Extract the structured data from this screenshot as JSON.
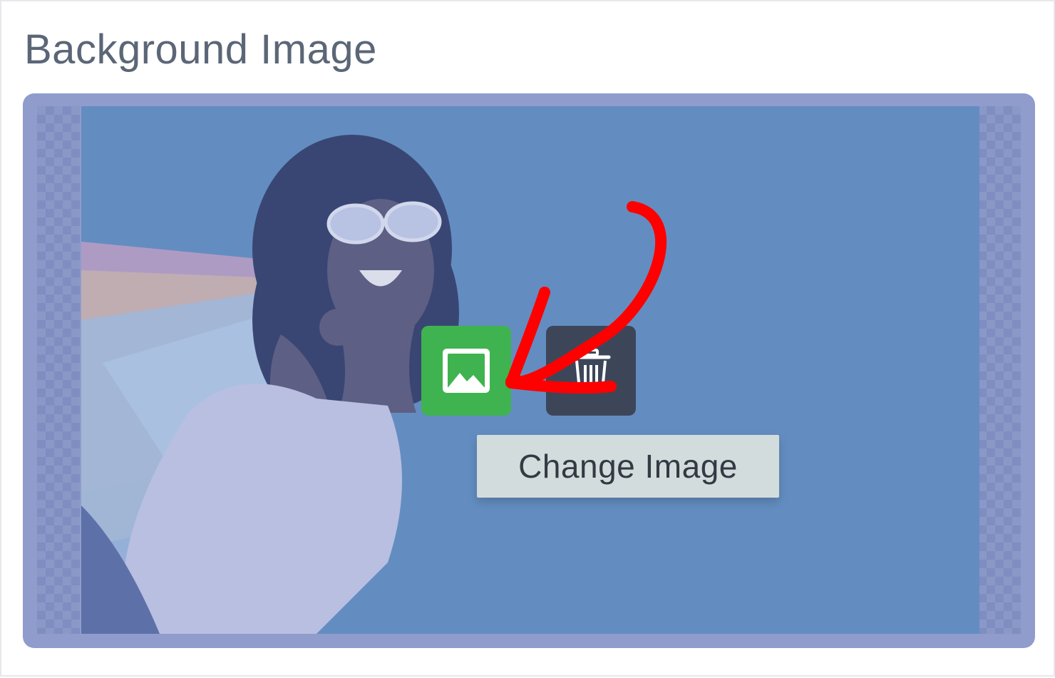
{
  "section": {
    "title": "Background Image"
  },
  "image_controls": {
    "change_button_icon": "image-icon",
    "delete_button_icon": "trash-icon",
    "tooltip": "Change Image"
  },
  "colors": {
    "change_button": "#3fb34f",
    "delete_button": "#3d4659",
    "annotation_arrow": "#ff0000",
    "panel_border": "#8f9ccc",
    "photo_background": "#6190c2"
  }
}
